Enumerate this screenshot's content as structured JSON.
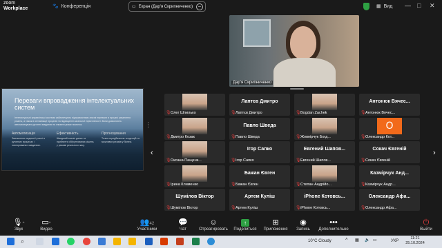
{
  "app": {
    "logo_line1": "zoom",
    "logo_line2": "Workplace"
  },
  "topbar": {
    "conference_label": "Конференція",
    "screen_share_label": "Екран (Дар'я Скрипниченко)",
    "view_label": "Вид",
    "minimize": "—",
    "maximize": "□",
    "close": "✕"
  },
  "shared_slide": {
    "title": "Переваги впровадження інтелектуальних систем",
    "body": "Інтелектуальні управлінські системи забезпечують підприємствам значні переваги в процесі ухвалення рішень, а також в оптимізації процесів та підвищенні загальної ефективності. Вони дозволяють автоматизувати рутинні завдання та знизити ризик помилок.",
    "columns": [
      {
        "heading": "Автоматизація",
        "text": "Зменшення людської участі в рутинних процесах і повторюваних завданнях."
      },
      {
        "heading": "Ефективність",
        "text": "Швидший аналіз даних та прийняття обґрунтованих рішень у режимі реального часу."
      },
      {
        "heading": "Прогнозування",
        "text": "Точне передбачення тенденцій та можливих ризиків у бізнесі."
      }
    ]
  },
  "speaker": {
    "name": "Дар'я Скрипниченко"
  },
  "gallery": {
    "tiles": [
      {
        "big": "",
        "name": "Олег Шпилько",
        "avatar": "face"
      },
      {
        "big": "Лаптєв Дмитро",
        "name": "Лаптєв Дмитро",
        "avatar": ""
      },
      {
        "big": "",
        "name": "Bogdan Zachek",
        "avatar": "face"
      },
      {
        "big": "Антонюк Вячес...",
        "name": "Антонюк Вячес...",
        "avatar": ""
      },
      {
        "big": "",
        "name": "Дмитро Козак",
        "avatar": "face"
      },
      {
        "big": "Павло Шведа",
        "name": "Павло Шведа",
        "avatar": ""
      },
      {
        "big": "",
        "name": "Жовнірчук Богд...",
        "avatar": "face"
      },
      {
        "big": "",
        "name": "Олександр Кот...",
        "avatar": "O"
      },
      {
        "big": "",
        "name": "Оксана Пащенк...",
        "avatar": "face"
      },
      {
        "big": "Ігор Сапко",
        "name": "Ігор Сапко",
        "avatar": ""
      },
      {
        "big": "Евгений Шапов...",
        "name": "Евгений Шапов...",
        "avatar": ""
      },
      {
        "big": "Сокач Євгеній",
        "name": "Сокач Євгеній",
        "avatar": ""
      },
      {
        "big": "",
        "name": "Ірина Клименко",
        "avatar": "face"
      },
      {
        "big": "Бажан Євген",
        "name": "Бажан Євген",
        "avatar": ""
      },
      {
        "big": "",
        "name": "Степан Андрійо...",
        "avatar": "face"
      },
      {
        "big": "Казмірчук Анд...",
        "name": "Казмірчук Андр...",
        "avatar": ""
      },
      {
        "big": "Шумілов Віктор",
        "name": "Шумілов Віктор",
        "avatar": ""
      },
      {
        "big": "Артем Куліш",
        "name": "Артем Куліш",
        "avatar": ""
      },
      {
        "big": "iPhone Котовсь...",
        "name": "iPhone Котовсь...",
        "avatar": ""
      },
      {
        "big": "Олександр Афа...",
        "name": "Олександр Афа...",
        "avatar": ""
      }
    ]
  },
  "toolbar": {
    "audio": "Звук",
    "video": "Видео",
    "participants": "Участники",
    "participants_count": "42",
    "chat": "Чат",
    "react": "Отреагировать",
    "share": "Поделиться",
    "apps": "Приложения",
    "record": "Запись",
    "more": "Дополнительно",
    "leave": "Выйти"
  },
  "taskbar": {
    "weather": "10°C Cloudy",
    "lang": "УКР",
    "time": "11:21",
    "date": "25.10.2024"
  }
}
